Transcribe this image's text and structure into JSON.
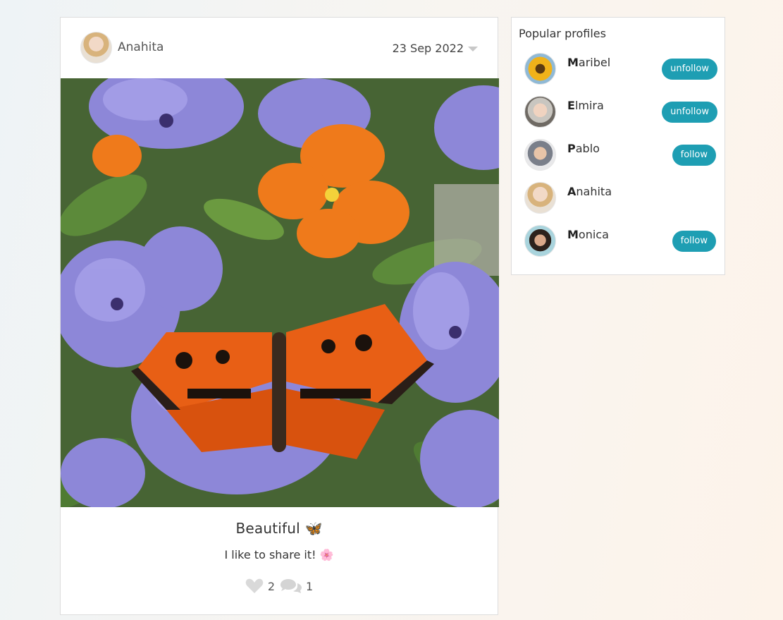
{
  "post": {
    "author": "Anahita",
    "date": "23 Sep 2022",
    "title": "Beautiful 🦋",
    "text": "I like to share it! 🌸",
    "likes": "2",
    "comments": "1"
  },
  "sidebar": {
    "title": "Popular profiles",
    "profiles": [
      {
        "initial": "M",
        "rest": "aribel",
        "button": "unfollow"
      },
      {
        "initial": "E",
        "rest": "lmira",
        "button": "unfollow"
      },
      {
        "initial": "P",
        "rest": "ablo",
        "button": "follow"
      },
      {
        "initial": "A",
        "rest": "nahita",
        "button": ""
      },
      {
        "initial": "M",
        "rest": "onica",
        "button": "follow"
      }
    ]
  },
  "colors": {
    "accent": "#1e9eb3",
    "background": "#f4f4f2"
  }
}
